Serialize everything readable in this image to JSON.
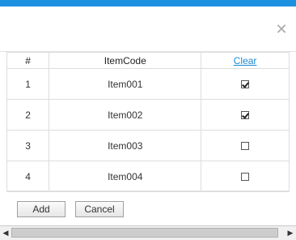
{
  "dialog": {
    "close_icon": "close-icon",
    "close_glyph": "✕"
  },
  "table": {
    "headers": {
      "num": "#",
      "code": "ItemCode",
      "clear": "Clear"
    },
    "rows": [
      {
        "num": "1",
        "code": "Item001",
        "checked": true
      },
      {
        "num": "2",
        "code": "Item002",
        "checked": true
      },
      {
        "num": "3",
        "code": "Item003",
        "checked": false
      },
      {
        "num": "4",
        "code": "Item004",
        "checked": false
      }
    ]
  },
  "footer": {
    "add_label": "Add",
    "cancel_label": "Cancel"
  },
  "scrollbar": {
    "left_arrow": "◀",
    "right_arrow": "▶"
  },
  "colors": {
    "accent": "#1e90e0",
    "link": "#1a8ad4"
  }
}
